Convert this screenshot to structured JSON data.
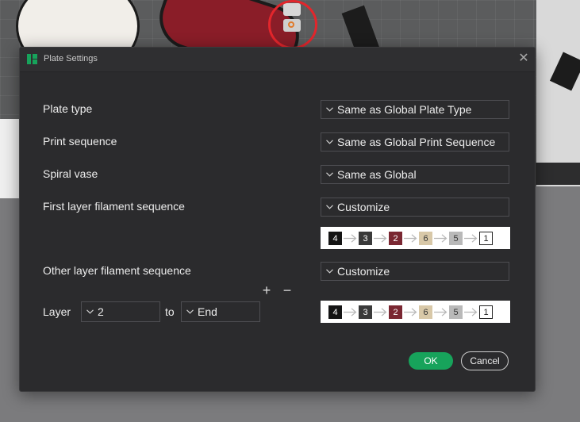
{
  "dialog": {
    "title": "Plate Settings",
    "close_glyph": "✕"
  },
  "rows": {
    "plate_type": {
      "label": "Plate type",
      "value": "Same as Global Plate Type"
    },
    "print_sequence": {
      "label": "Print sequence",
      "value": "Same as Global Print Sequence"
    },
    "spiral_vase": {
      "label": "Spiral vase",
      "value": "Same as Global"
    },
    "first_layer": {
      "label": "First layer filament sequence",
      "value": "Customize"
    },
    "other_layer": {
      "label": "Other layer filament sequence",
      "value": "Customize"
    }
  },
  "first_sequence": [
    {
      "text": "4",
      "bg": "#141414",
      "fg": "#ffffff",
      "border": "#141414"
    },
    {
      "text": "3",
      "bg": "#3a3a3a",
      "fg": "#ffffff",
      "border": "#3a3a3a"
    },
    {
      "text": "2",
      "bg": "#7a2732",
      "fg": "#ffffff",
      "border": "#7a2732"
    },
    {
      "text": "6",
      "bg": "#d8c8a8",
      "fg": "#333333",
      "border": "#d8c8a8"
    },
    {
      "text": "5",
      "bg": "#b9b9b9",
      "fg": "#333333",
      "border": "#b9b9b9"
    },
    {
      "text": "1",
      "bg": "#ffffff",
      "fg": "#222222",
      "border": "#222222"
    }
  ],
  "other_sequence": [
    {
      "text": "4",
      "bg": "#141414",
      "fg": "#ffffff",
      "border": "#141414"
    },
    {
      "text": "3",
      "bg": "#3a3a3a",
      "fg": "#ffffff",
      "border": "#3a3a3a"
    },
    {
      "text": "2",
      "bg": "#7a2732",
      "fg": "#ffffff",
      "border": "#7a2732"
    },
    {
      "text": "6",
      "bg": "#d8c8a8",
      "fg": "#333333",
      "border": "#d8c8a8"
    },
    {
      "text": "5",
      "bg": "#b9b9b9",
      "fg": "#333333",
      "border": "#b9b9b9"
    },
    {
      "text": "1",
      "bg": "#ffffff",
      "fg": "#222222",
      "border": "#222222"
    }
  ],
  "layer_range": {
    "label": "Layer",
    "from": "2",
    "to_label": "to",
    "to": "End",
    "add_glyph": "+",
    "remove_glyph": "−"
  },
  "buttons": {
    "ok": "OK",
    "cancel": "Cancel"
  },
  "colors": {
    "accent": "#17a35b",
    "dialog_bg": "#2b2b2d",
    "highlight_circle": "#e3262c"
  }
}
